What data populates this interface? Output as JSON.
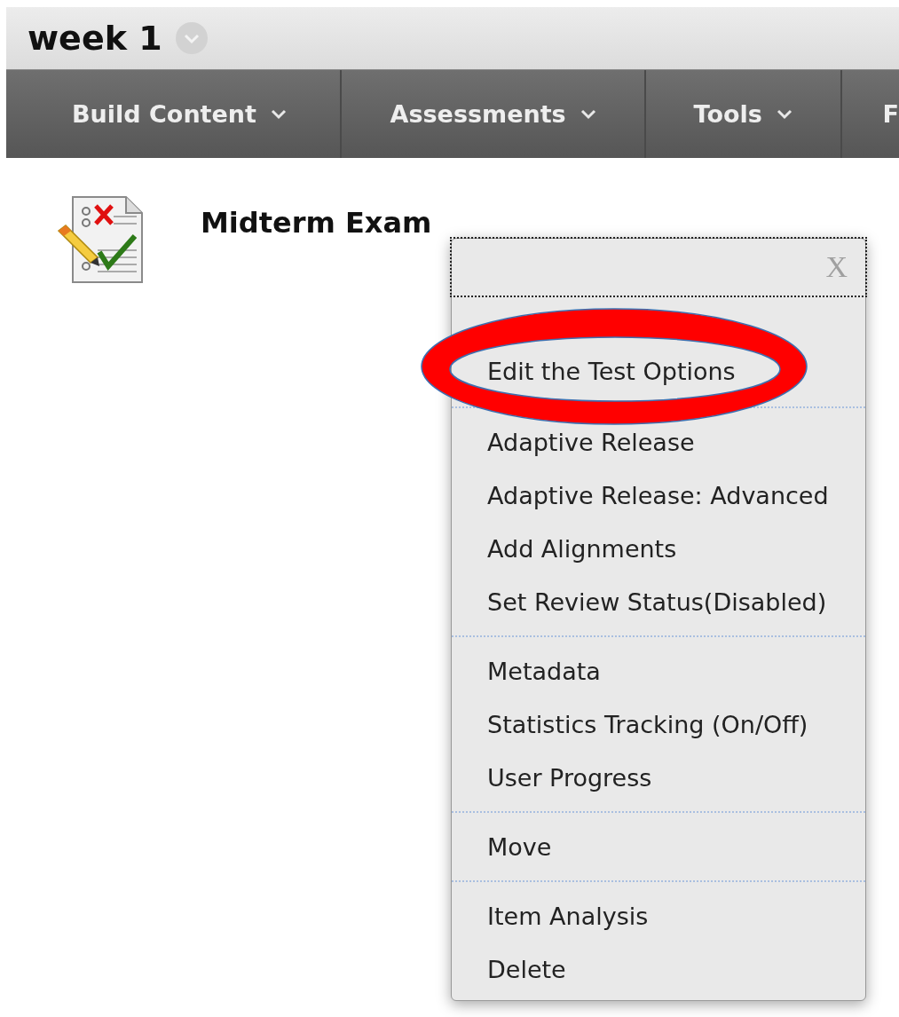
{
  "page_title": "week 1",
  "nav": [
    {
      "label": "Build Content"
    },
    {
      "label": "Assessments"
    },
    {
      "label": "Tools"
    },
    {
      "label": "F"
    }
  ],
  "item": {
    "title": "Midterm Exam"
  },
  "menu": {
    "close": "X",
    "groups": [
      [
        "Edit the Test Options"
      ],
      [
        "Adaptive Release",
        "Adaptive Release: Advanced",
        "Add Alignments",
        "Set Review Status(Disabled)"
      ],
      [
        "Metadata",
        "Statistics Tracking (On/Off)",
        "User Progress"
      ],
      [
        "Move"
      ],
      [
        "Item Analysis",
        "Delete"
      ]
    ]
  }
}
